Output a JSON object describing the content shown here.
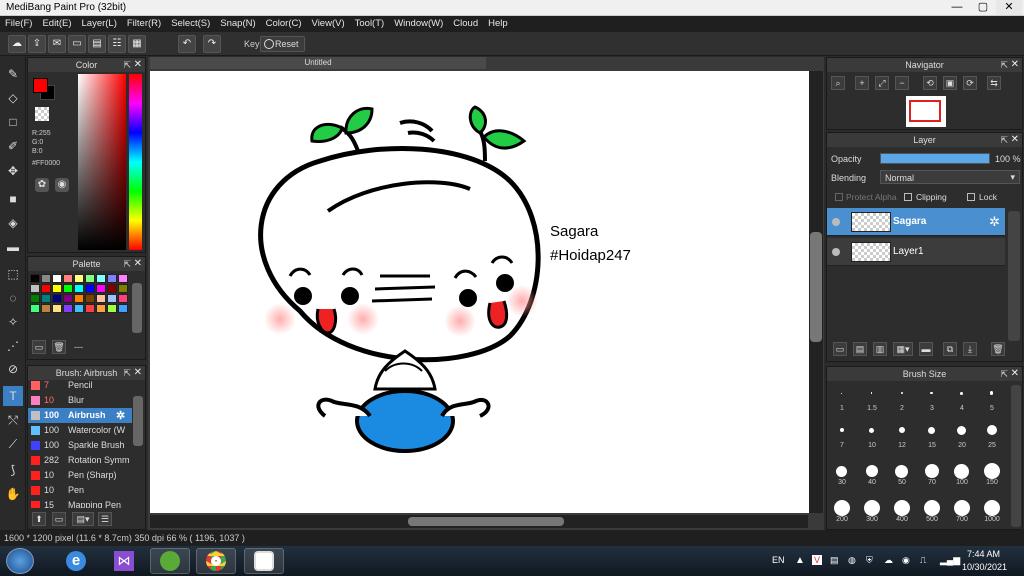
{
  "window": {
    "title": "MediBang Paint Pro (32bit)",
    "minimize_icon": "—",
    "maximize_icon": "▢",
    "close_icon": "✕"
  },
  "menu": [
    "File(F)",
    "Edit(E)",
    "Layer(L)",
    "Filter(R)",
    "Select(S)",
    "Snap(N)",
    "Color(C)",
    "View(V)",
    "Tool(T)",
    "Window(W)",
    "Cloud",
    "Help"
  ],
  "toolbar": {
    "key_label": "Key",
    "reset_label": "Reset"
  },
  "color_panel": {
    "title": "Color",
    "r": "R:255",
    "g": "G:0",
    "b": "B:0",
    "hex": "#FF0000",
    "fg_color": "#ff0000",
    "bg_color": "#000000"
  },
  "palette_panel": {
    "title": "Palette",
    "separator_label": "---",
    "colors": [
      "#000000",
      "#888888",
      "#ffffff",
      "#ff8080",
      "#ffff80",
      "#80ff80",
      "#80ffff",
      "#8080ff",
      "#ff80ff",
      "#c0c0c0",
      "#ff0000",
      "#ffff00",
      "#00ff00",
      "#00ffff",
      "#0000ff",
      "#ff00ff",
      "#800000",
      "#808000",
      "#008000",
      "#008080",
      "#000080",
      "#800080",
      "#ff8000",
      "#804000",
      "#ffc0a0",
      "#a0c0ff",
      "#ff4080",
      "#40ff80",
      "#c08040",
      "#ffe080",
      "#8040ff",
      "#40c0ff",
      "#ff4040",
      "#ffa040",
      "#a0ff40",
      "#40a0ff"
    ]
  },
  "brush_panel": {
    "title": "Brush: Airbrush",
    "items": [
      {
        "size": "7",
        "name": "Pencil",
        "color": "#ff6060"
      },
      {
        "size": "10",
        "name": "Blur",
        "color": "#ff80c0"
      },
      {
        "size": "100",
        "name": "Airbrush",
        "color": "#c0c0c0",
        "active": true
      },
      {
        "size": "100",
        "name": "Watercolor (W",
        "color": "#60c0ff"
      },
      {
        "size": "100",
        "name": "Sparkle Brush",
        "color": "#4040ff"
      },
      {
        "size": "282",
        "name": "Rotation Symm",
        "color": "#ff2020"
      },
      {
        "size": "10",
        "name": "Pen (Sharp)",
        "color": "#ff2020"
      },
      {
        "size": "10",
        "name": "Pen",
        "color": "#ff2020"
      },
      {
        "size": "15",
        "name": "Mapping Pen",
        "color": "#ff2020"
      }
    ]
  },
  "canvas": {
    "tab_title": "Untitled",
    "text_line1": "Sagara",
    "text_line2": "#Hoidap247"
  },
  "navigator": {
    "title": "Navigator"
  },
  "layer_panel": {
    "title": "Layer",
    "opacity_label": "Opacity",
    "opacity_value": "100 %",
    "opacity_fraction": 1.0,
    "blending_label": "Blending",
    "blending_value": "Normal",
    "protect_alpha": "Protect Alpha",
    "clipping": "Clipping",
    "lock": "Lock",
    "layers": [
      {
        "name": "Sagara",
        "active": true
      },
      {
        "name": "Layer1",
        "active": false
      }
    ]
  },
  "brush_size_panel": {
    "title": "Brush Size",
    "sizes": [
      "1",
      "1.5",
      "2",
      "3",
      "4",
      "5",
      "7",
      "10",
      "12",
      "15",
      "20",
      "25",
      "30",
      "40",
      "50",
      "70",
      "100",
      "150",
      "200",
      "300",
      "400",
      "500",
      "700",
      "1000"
    ]
  },
  "status": {
    "text": "1600 * 1200 pixel   (11.6 * 8.7cm)   350 dpi   66 %   ( 1196, 1037 )"
  },
  "tray": {
    "lang": "EN",
    "time": "7:44 AM",
    "date": "10/30/2021"
  }
}
